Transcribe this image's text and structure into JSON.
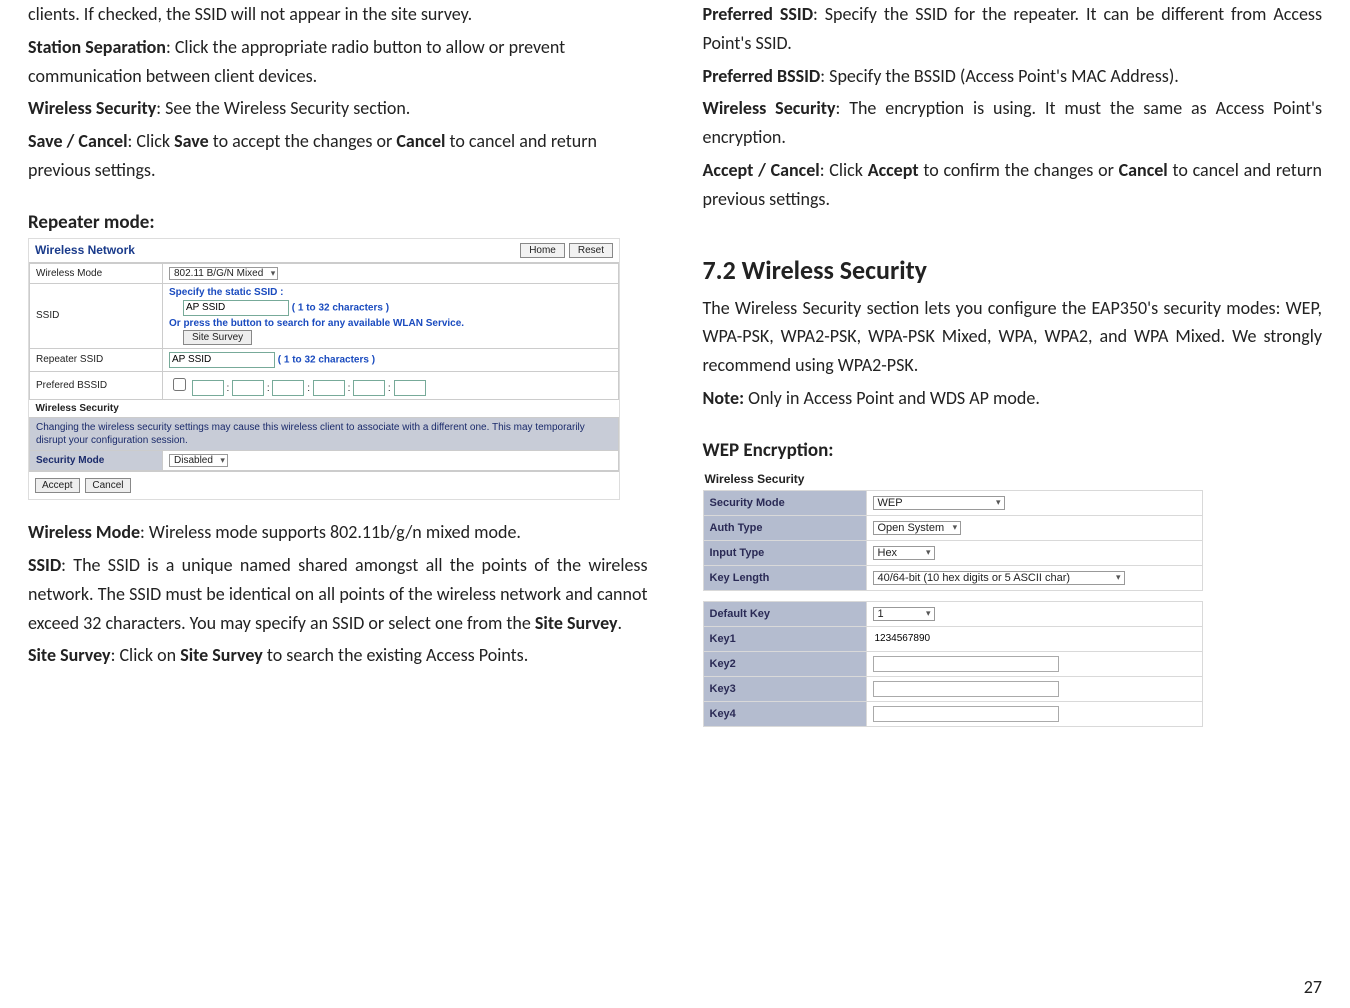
{
  "page_number": "27",
  "left": {
    "p1": "clients. If checked, the SSID will not appear in the site survey.",
    "p2_b": "Station Separation",
    "p2": ": Click the appropriate radio button to allow or prevent communication between client devices.",
    "p3_b": "Wireless Security",
    "p3": ": See the Wireless Security section.",
    "p4_b1": "Save / Cancel",
    "p4_mid1": ": Click ",
    "p4_b2": "Save",
    "p4_mid2": " to accept the changes or ",
    "p4_b3": "Cancel",
    "p4_end": " to cancel and return previous settings.",
    "h_repeater": "Repeater mode:",
    "shot": {
      "title": "Wireless Network",
      "home": "Home",
      "reset": "Reset",
      "row_wmode": "Wireless Mode",
      "wmode_val": "802.11 B/G/N Mixed",
      "row_ssid": "SSID",
      "ssid_line1": "Specify the static SSID  :",
      "ssid_input": "AP SSID",
      "ssid_chars": "( 1 to 32 characters )",
      "ssid_line2": "Or press the button to search for any available WLAN Service.",
      "site_survey_btn": "Site Survey",
      "row_rssid": "Repeater SSID",
      "rssid_input": "AP SSID",
      "rssid_chars": "( 1 to 32 characters )",
      "row_pbssid": "Prefered BSSID",
      "wsec_hdr": "Wireless Security",
      "warn": "Changing the wireless security settings may cause this wireless client to associate with a different one. This may temporarily disrupt your configuration session.",
      "row_secmode": "Security Mode",
      "secmode_val": "Disabled",
      "accept": "Accept",
      "cancel": "Cancel"
    },
    "p5_b": "Wireless Mode",
    "p5": ": Wireless mode supports 802.11b/g/n mixed mode.",
    "p6_b": "SSID",
    "p6": ": The SSID is a unique named shared amongst all the points of the wireless network. The SSID must be identical on all points of the wireless network and cannot exceed 32 characters. You may specify an SSID or select one from the ",
    "p6_b2": "Site Survey",
    "p6_end": ".",
    "p7_b": "Site Survey",
    "p7_mid": ": Click on ",
    "p7_b2": "Site Survey",
    "p7_end": " to search the existing Access Points."
  },
  "right": {
    "p1_b": "Preferred SSID",
    "p1": ": Specify the SSID for the repeater. It can be different from Access Point's SSID.",
    "p2_b": "Preferred BSSID",
    "p2": ": Specify the BSSID (Access Point's MAC Address).",
    "p3_b": "Wireless Security",
    "p3": ": The encryption is using. It must the same as Access Point's encryption.",
    "p4_b1": "Accept / Cancel",
    "p4_mid1": ": Click ",
    "p4_b2": "Accept",
    "p4_mid2": " to confirm the changes or ",
    "p4_b3": "Cancel",
    "p4_end": " to cancel and return previous settings.",
    "h_72": "7.2    Wireless Security",
    "p5": "The Wireless Security section lets you configure the EAP350's security modes: WEP, WPA-PSK, WPA2-PSK, WPA-PSK Mixed, WPA, WPA2, and WPA Mixed. We strongly recommend using WPA2-PSK.",
    "p6_b": "Note:",
    "p6": " Only in Access Point and WDS AP mode.",
    "h_wep": "WEP Encryption:",
    "shot2": {
      "hdr": "Wireless Security",
      "secmode": "Security Mode",
      "secmode_v": "WEP",
      "auth": "Auth Type",
      "auth_v": "Open System",
      "input": "Input Type",
      "input_v": "Hex",
      "klen": "Key Length",
      "klen_v": "40/64-bit (10 hex digits or 5 ASCII char)",
      "defkey": "Default Key",
      "defkey_v": "1",
      "k1": "Key1",
      "k1_v": "1234567890",
      "k2": "Key2",
      "k3": "Key3",
      "k4": "Key4"
    }
  }
}
